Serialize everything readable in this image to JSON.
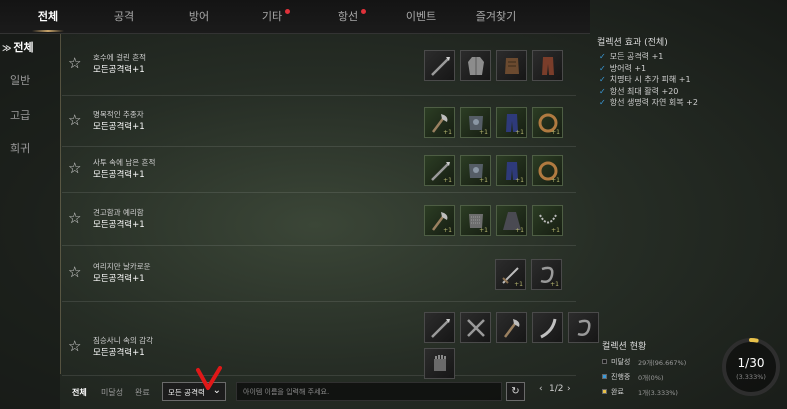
{
  "tabs": [
    {
      "label": "전체",
      "active": true,
      "new": false
    },
    {
      "label": "공격",
      "active": false,
      "new": false
    },
    {
      "label": "방어",
      "active": false,
      "new": false
    },
    {
      "label": "기타",
      "active": false,
      "new": true
    },
    {
      "label": "항선",
      "active": false,
      "new": true
    },
    {
      "label": "이벤트",
      "active": false,
      "new": false
    },
    {
      "label": "즐겨찾기",
      "active": false,
      "new": false
    }
  ],
  "sidebar": {
    "items": [
      {
        "label": "전체",
        "active": true
      },
      {
        "label": "일반",
        "active": false
      },
      {
        "label": "고급",
        "active": false
      },
      {
        "label": "희귀",
        "active": false
      }
    ]
  },
  "collections": [
    {
      "title": "호수에 걸린 흔적",
      "effect": "모든공격력+1",
      "items": [
        {
          "icon": "spear-icon",
          "tier": "gray",
          "plus": ""
        },
        {
          "icon": "robe-icon",
          "tier": "gray",
          "plus": ""
        },
        {
          "icon": "leather-armor-icon",
          "tier": "gray",
          "plus": ""
        },
        {
          "icon": "trousers-icon",
          "tier": "gray",
          "plus": ""
        }
      ]
    },
    {
      "title": "명목적인 추종자",
      "effect": "모든공격력+1",
      "items": [
        {
          "icon": "axe-icon",
          "tier": "green",
          "plus": "+1"
        },
        {
          "icon": "chest-armor-icon",
          "tier": "green",
          "plus": "+1"
        },
        {
          "icon": "blue-pants-icon",
          "tier": "green",
          "plus": "+1"
        },
        {
          "icon": "ring-icon",
          "tier": "green",
          "plus": "+1"
        }
      ]
    },
    {
      "title": "사투 속에 남은 흔적",
      "effect": "모든공격력+1",
      "items": [
        {
          "icon": "spear-icon",
          "tier": "green",
          "plus": "+1"
        },
        {
          "icon": "chest-armor-icon",
          "tier": "green",
          "plus": "+1"
        },
        {
          "icon": "blue-pants-icon",
          "tier": "green",
          "plus": "+1"
        },
        {
          "icon": "ring-icon",
          "tier": "green",
          "plus": "+1"
        }
      ]
    },
    {
      "title": "견고함과 예리함",
      "effect": "모든공격력+1",
      "items": [
        {
          "icon": "axe-icon",
          "tier": "green",
          "plus": "+1"
        },
        {
          "icon": "chain-armor-icon",
          "tier": "green",
          "plus": "+1"
        },
        {
          "icon": "cloak-icon",
          "tier": "green",
          "plus": "+1"
        },
        {
          "icon": "necklace-icon",
          "tier": "green",
          "plus": "+1"
        }
      ]
    },
    {
      "title": "여리지만 날카로운",
      "effect": "모든공격력+1",
      "items": [
        {
          "icon": "sword-icon",
          "tier": "gray",
          "plus": "+1"
        },
        {
          "icon": "bracelet-icon",
          "tier": "gray",
          "plus": "+1"
        }
      ]
    },
    {
      "title": "짐승사니 속의 감각",
      "effect": "모든공격력+1",
      "items": [
        {
          "icon": "spear-icon",
          "tier": "gray",
          "plus": ""
        },
        {
          "icon": "crossed-weapons-icon",
          "tier": "gray",
          "plus": ""
        },
        {
          "icon": "axe-icon",
          "tier": "gray",
          "plus": ""
        },
        {
          "icon": "curved-blade-icon",
          "tier": "gray",
          "plus": ""
        },
        {
          "icon": "bracelet-icon",
          "tier": "gray",
          "plus": ""
        },
        {
          "icon": "gauntlet-icon",
          "tier": "gray",
          "plus": ""
        }
      ]
    }
  ],
  "effects_panel": {
    "title": "컬렉션 효과 (전체)",
    "effects": [
      "모든 공격력 +1",
      "방어력 +1",
      "치명타 시 추가 피해 +1",
      "항선 최대 활력 +20",
      "항선 생명력 자연 회복 +2"
    ],
    "check_color": "#3a9ad9"
  },
  "status_panel": {
    "title": "컬렉션 현황",
    "rows": [
      {
        "label": "미달성",
        "count": "29개(96.667%)",
        "color": "#1a1a1a"
      },
      {
        "label": "진행중",
        "count": "0개(0%)",
        "color": "#3a9ad9"
      },
      {
        "label": "완료",
        "count": "1개(3.333%)",
        "color": "#e8c14a"
      }
    ],
    "ring_main": "1/30",
    "ring_sub": "(3.333%)",
    "progress": 0.0333
  },
  "bottom": {
    "filters": [
      {
        "label": "전체",
        "active": true
      },
      {
        "label": "미달성",
        "active": false
      },
      {
        "label": "완료",
        "active": false
      }
    ],
    "select_value": "모든 공격력",
    "search_placeholder": "아이템 이름을 입력해 주세요.",
    "page": "1/2",
    "prev": "‹",
    "next": "›",
    "refresh": "↻"
  },
  "colors": {
    "accent": "#c9a56a",
    "new_dot": "#e0313a",
    "annotation": "#e01818"
  }
}
